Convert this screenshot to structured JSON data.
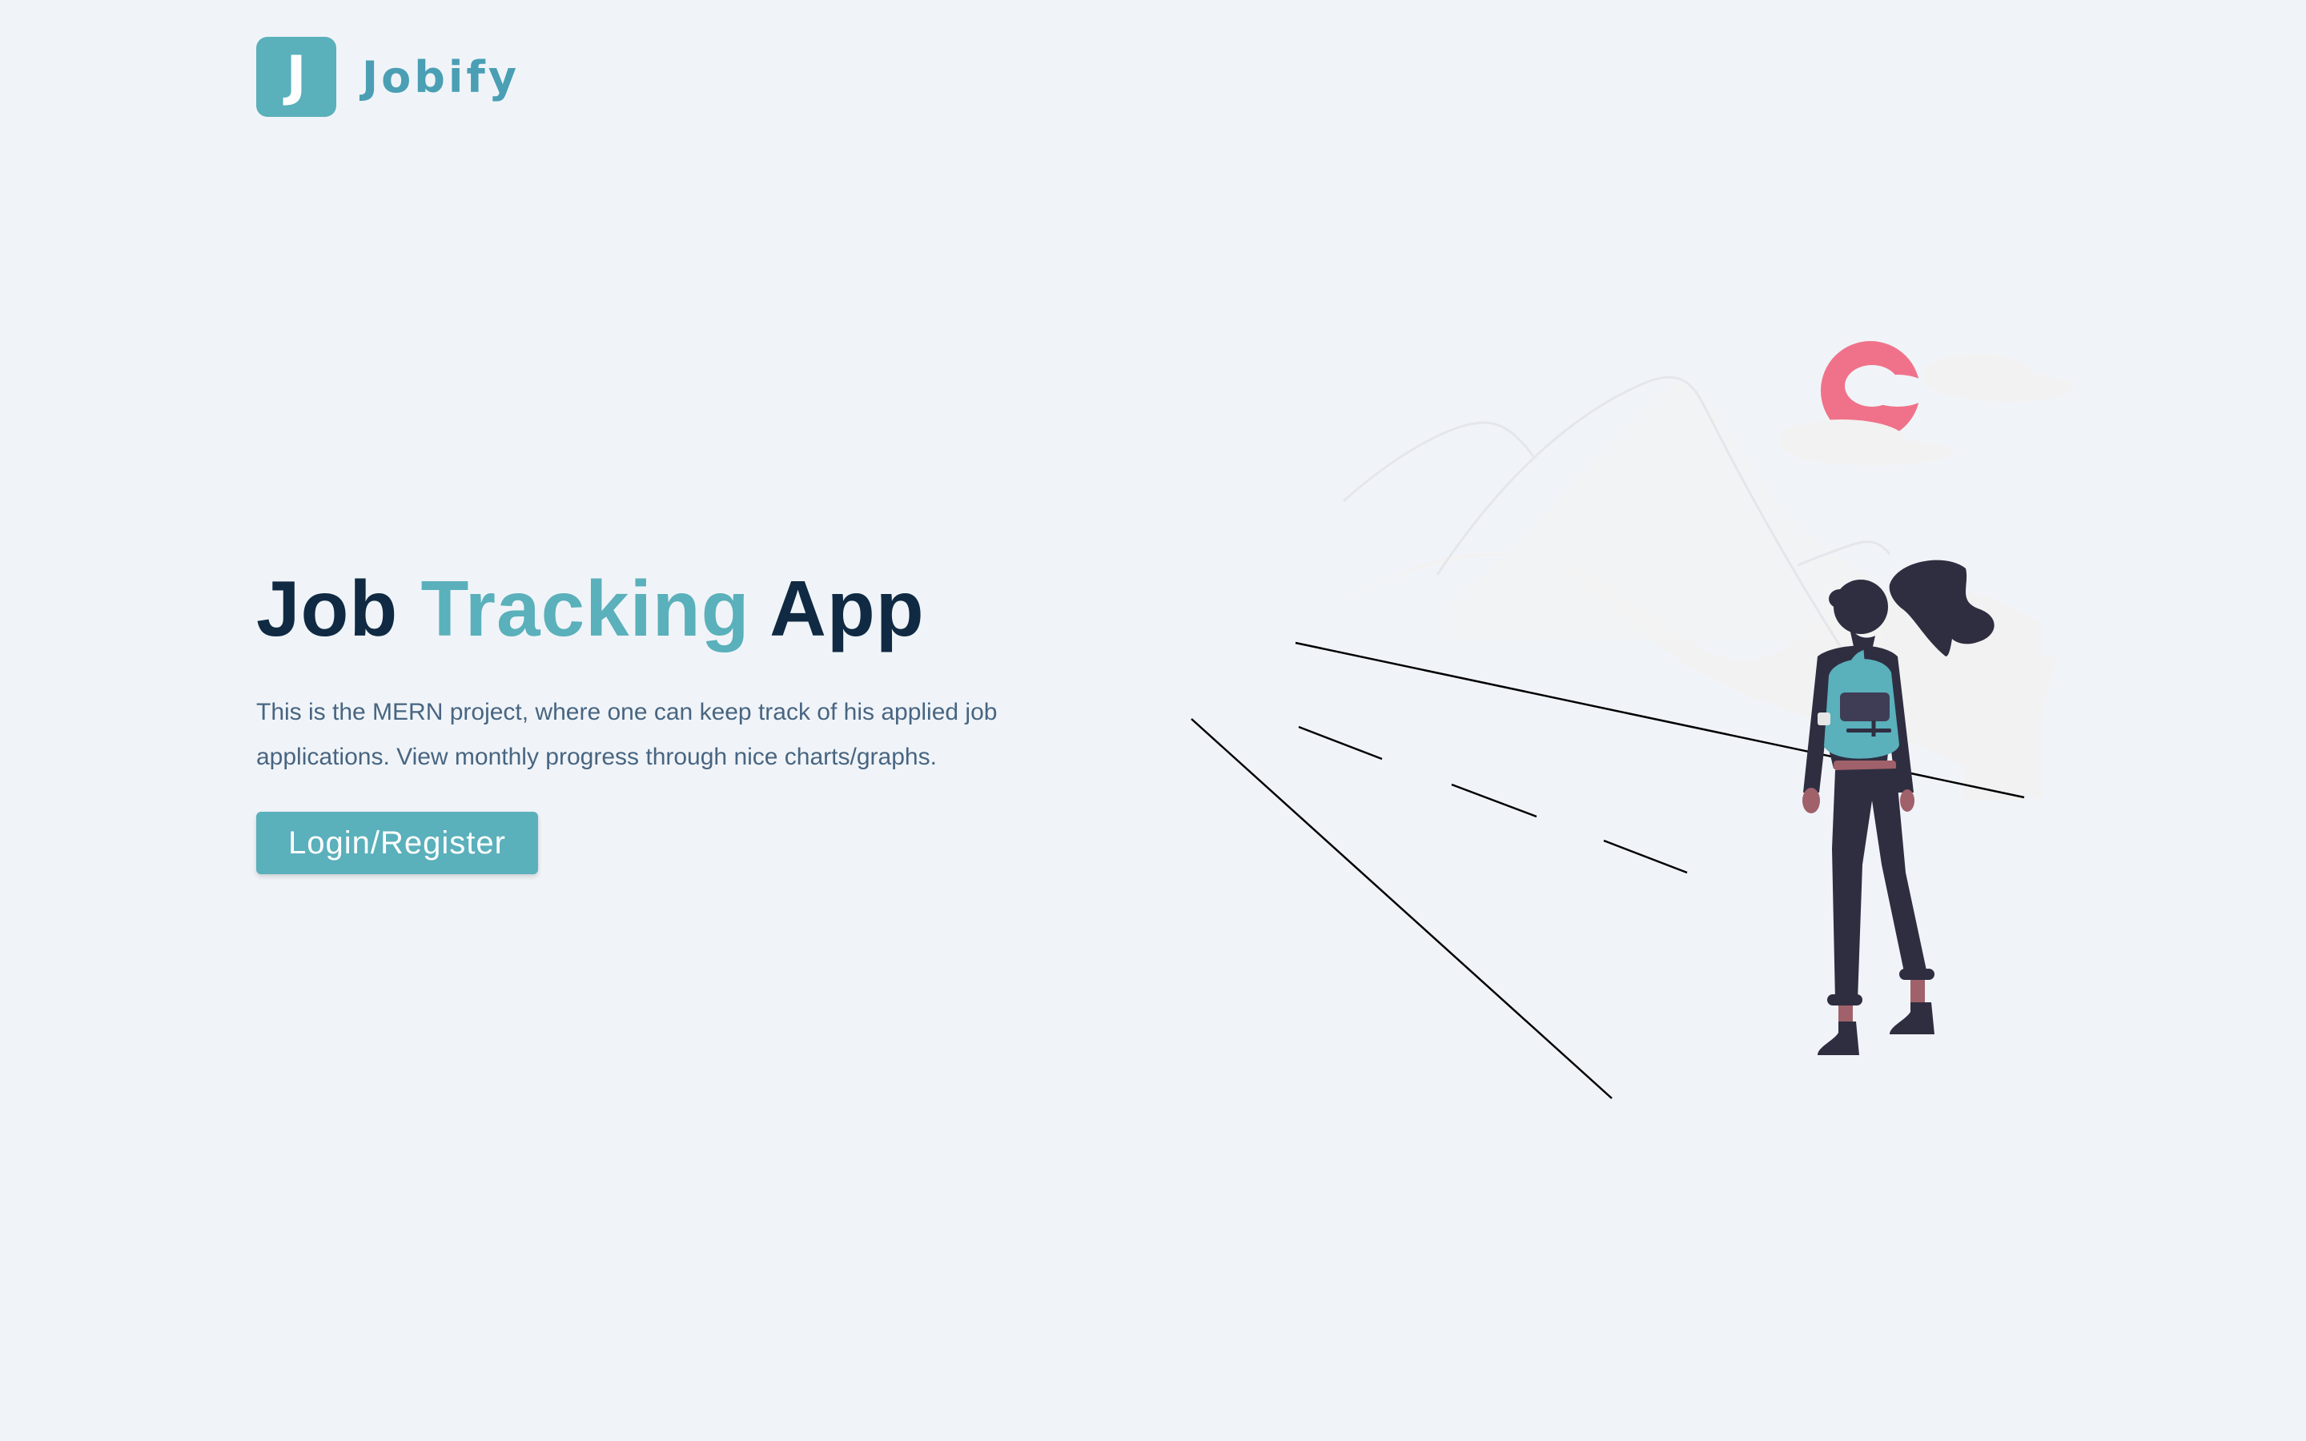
{
  "navbar": {
    "logo_letter": "J",
    "brand_name": "Jobify"
  },
  "hero": {
    "title_part1": "Job ",
    "title_accent": "Tracking",
    "title_part2": " App",
    "description": "This is the MERN project, where one can keep track of his applied job applications. View monthly progress through nice charts/graphs.",
    "cta_label": "Login/Register"
  },
  "illustration": {
    "icon": "woman-hiker-landscape-illustration"
  },
  "colors": {
    "background": "#f0f4f8",
    "primary": "#5ab0bb",
    "brand_text": "#4a9fb4",
    "heading": "#102a43",
    "body_text": "#486581",
    "sun": "#f0728a",
    "figure_dark": "#2f2e41"
  }
}
